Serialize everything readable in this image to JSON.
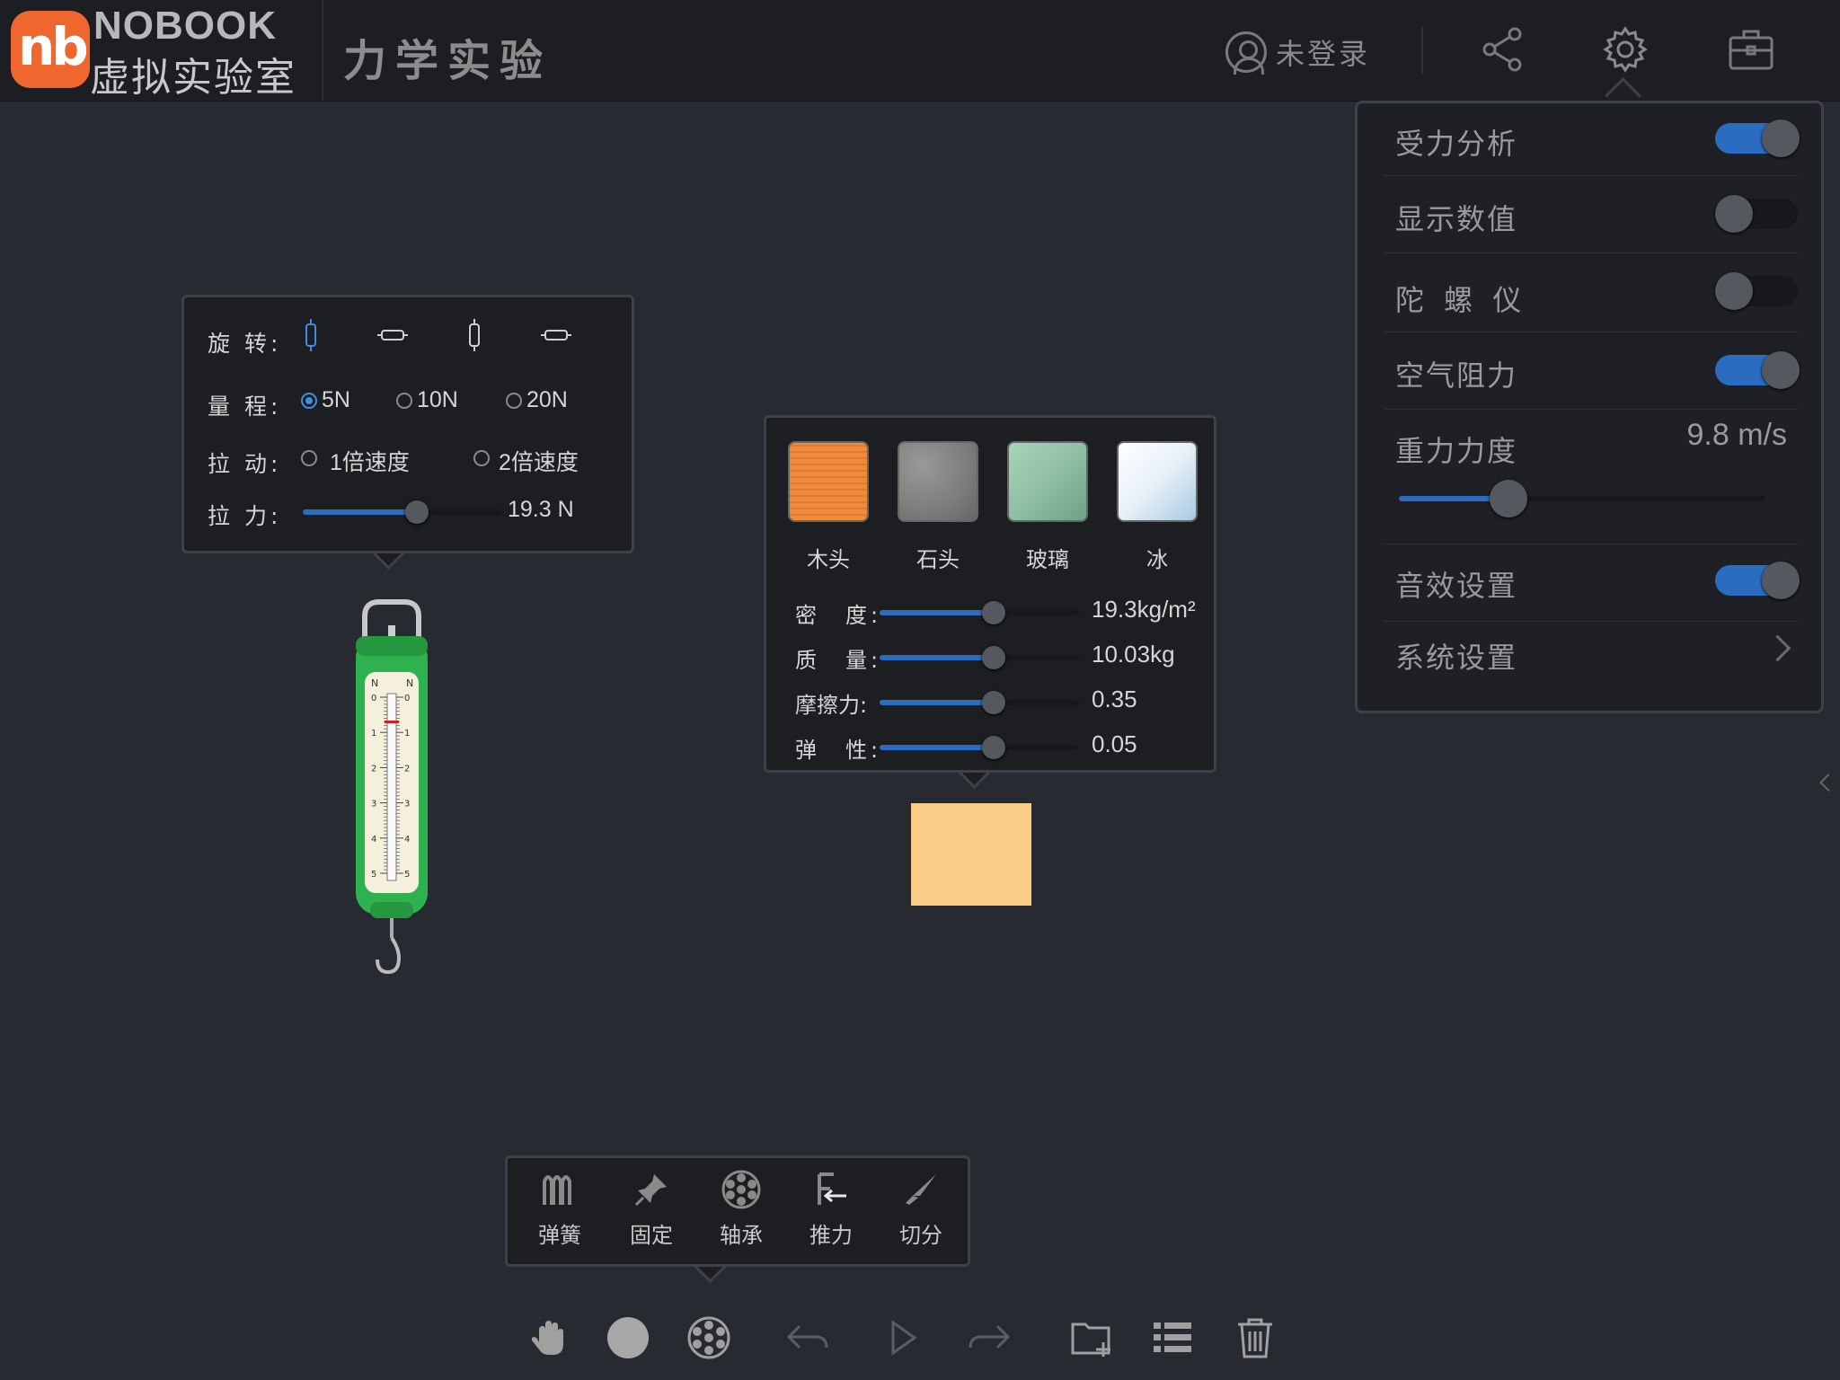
{
  "header": {
    "brand_badge": "nb",
    "brand_en": "NOBOOK",
    "brand_cn": "虚拟实验室",
    "title": "力学实验",
    "user_label": "未登录",
    "icons": [
      "user-icon",
      "share-icon",
      "gear-icon",
      "toolbox-icon"
    ]
  },
  "settings": {
    "force_analysis": {
      "label": "受力分析",
      "on": true
    },
    "show_values": {
      "label": "显示数值",
      "on": false
    },
    "gyroscope": {
      "label": "陀 螺 仪",
      "on": false
    },
    "air_resistance": {
      "label": "空气阻力",
      "on": true
    },
    "gravity": {
      "label": "重力力度",
      "value": "9.8 m/s",
      "level": 0.3
    },
    "sound": {
      "label": "音效设置",
      "on": true
    },
    "system": {
      "label": "系统设置"
    }
  },
  "spring_panel": {
    "rotate_label": "旋 转:",
    "rotate_icons": [
      "vertical-scale-icon",
      "horizontal-scale-icon",
      "vertical-scale-inverted-icon",
      "horizontal-scale-inverted-icon"
    ],
    "range_label": "量 程:",
    "range_options": [
      "5N",
      "10N",
      "20N"
    ],
    "range_selected": "5N",
    "pull_label": "拉 动:",
    "pull_options": [
      "1倍速度",
      "2倍速度"
    ],
    "force_label": "拉 力:",
    "force_value": "19.3 N",
    "force_level": 0.57
  },
  "spring_scale": {
    "unit_left": "N",
    "unit_right": "N",
    "ticks": [
      "0",
      "1",
      "2",
      "3",
      "4",
      "5"
    ]
  },
  "material_panel": {
    "materials": [
      {
        "name": "木头",
        "color": "#f08a3c"
      },
      {
        "name": "石头",
        "color": "#7c7c7a"
      },
      {
        "name": "玻璃",
        "color": "#8fbfa4"
      },
      {
        "name": "冰",
        "color": "#e6f1f8"
      }
    ],
    "properties": [
      {
        "label": "密　度:",
        "value": "19.3kg/m²",
        "level": 0.57
      },
      {
        "label": "质　量:",
        "value": "10.03kg",
        "level": 0.57
      },
      {
        "label": "摩擦力:",
        "value": "0.35",
        "level": 0.57
      },
      {
        "label": "弹　性:",
        "value": "0.05",
        "level": 0.57
      }
    ]
  },
  "block": {
    "color": "#fbce88"
  },
  "tools": [
    {
      "label": "弹簧",
      "icon": "spring-icon"
    },
    {
      "label": "固定",
      "icon": "pin-icon"
    },
    {
      "label": "轴承",
      "icon": "bearing-icon"
    },
    {
      "label": "推力",
      "icon": "push-force-icon"
    },
    {
      "label": "切分",
      "icon": "knife-icon"
    }
  ],
  "bottom_toolbar": [
    "hand-icon",
    "circle-icon",
    "gear-wheel-icon",
    "undo-icon",
    "play-icon",
    "redo-icon",
    "folder-add-icon",
    "list-icon",
    "trash-icon"
  ],
  "colors": {
    "accent": "#2a6cc0",
    "brand": "#f0662f",
    "background": "#272a31",
    "scale_body": "#2fb150"
  }
}
